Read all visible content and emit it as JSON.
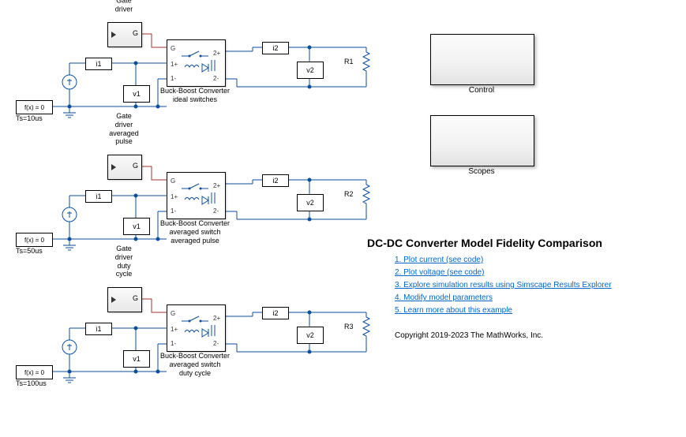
{
  "title": "DC-DC Converter Model Fidelity Comparison",
  "links": {
    "l1": "1. Plot current (see code)",
    "l2": "2. Plot voltage (see code)",
    "l3": "3. Explore simulation results using Simscape Results Explorer",
    "l4": "4. Modify model parameters",
    "l5": "5. Learn more about this example"
  },
  "copyright": "Copyright 2019-2023 The MathWorks, Inc.",
  "panel_control": "Control",
  "panel_scopes": "Scopes",
  "circuits": [
    {
      "gate_label": "Gate driver",
      "gate_inner": "G",
      "conv_label": "Buck-Boost Converter\nideal switches",
      "pg": "G",
      "p1p": "1+",
      "p1m": "1-",
      "p2p": "2+",
      "p2m": "2-",
      "i1": "i1",
      "v1": "v1",
      "i2": "i2",
      "v2": "v2",
      "R": "R1",
      "solver": "f(x) = 0",
      "ts": "Ts=10us"
    },
    {
      "gate_label": "Gate driver\naveraged pulse",
      "gate_inner": "G",
      "conv_label": "Buck-Boost Converter\naveraged switch\naveraged pulse",
      "pg": "G",
      "p1p": "1+",
      "p1m": "1-",
      "p2p": "2+",
      "p2m": "2-",
      "i1": "i1",
      "v1": "v1",
      "i2": "i2",
      "v2": "v2",
      "R": "R2",
      "solver": "f(x) = 0",
      "ts": "Ts=50us"
    },
    {
      "gate_label": "Gate driver\nduty cycle",
      "gate_inner": "G",
      "conv_label": "Buck-Boost Converter\naveraged switch\nduty cycle",
      "pg": "G",
      "p1p": "1+",
      "p1m": "1-",
      "p2p": "2+",
      "p2m": "2-",
      "i1": "i1",
      "v1": "v1",
      "i2": "i2",
      "v2": "v2",
      "R": "R3",
      "solver": "f(x) = 0",
      "ts": "Ts=100us"
    }
  ]
}
